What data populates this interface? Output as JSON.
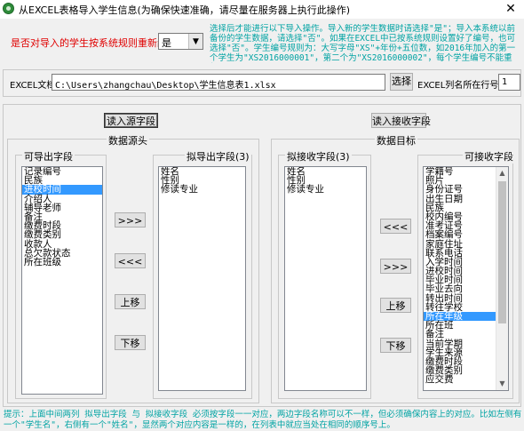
{
  "window": {
    "title": "从EXCEL表格导入学生信息(为确保快速准确，请尽量在服务器上执行此操作)",
    "close_glyph": "✕"
  },
  "top": {
    "renumber_label": "是否对导入的学生按系统规则重新编号",
    "renumber_value": "是",
    "renumber_help": "选择后才能进行以下导入操作。导入新的学生数据时请选择\"是\"；导入本系统以前备份的学生数据，请选择\"否\"。如果在EXCEL中已按系统规则设置好了编号，也可选择\"否\"。学生编号规则为：大写字母\"XS\"+年份+五位数，如2016年加入的第一个学生为\"XS2016000001\"，第二个为\"XS2016000002\"，每个学生编号不能重复。"
  },
  "file": {
    "label": "EXCEL文档",
    "path": "C:\\Users\\zhangchau\\Desktop\\学生信息表1.xlsx",
    "browse_label": "选择",
    "header_row_label": "EXCEL列名所在行号",
    "header_row_value": "1"
  },
  "source": {
    "load_button": "读入源字段",
    "group_title": "数据源头",
    "available_title": "可导出字段",
    "available_items": [
      "记录编号",
      "民族",
      "进校时间",
      "介绍人",
      "辅导老师",
      "备注",
      "缴费时段",
      "缴费类别",
      "收款人",
      "总欠款状态",
      "所在班级"
    ],
    "available_selected": 2,
    "export_title": "拟导出字段(3)",
    "export_items": [
      "姓名",
      "性别",
      "修读专业"
    ]
  },
  "target": {
    "load_button": "读入接收字段",
    "group_title": "数据目标",
    "receive_title": "拟接收字段(3)",
    "receive_items": [
      "姓名",
      "性别",
      "修读专业"
    ],
    "available_title": "可接收字段",
    "available_items": [
      "学籍号",
      "照片",
      "身份证号",
      "出生日期",
      "民族",
      "校内编号",
      "准考证号",
      "档案编号",
      "家庭住址",
      "联系电话",
      "入学时间",
      "进校时间",
      "毕业时间",
      "毕业去向",
      "转出时间",
      "转往学校",
      "所在年级",
      "所在班",
      "备注",
      "当前学期",
      "学生来源",
      "缴费时段",
      "缴费类别",
      "应交费"
    ],
    "available_selected": 16
  },
  "buttons": {
    "move_right": ">>>",
    "move_left": "<<<",
    "move_up": "上移",
    "move_down": "下移"
  },
  "hint": "提示：上面中间两列 拟导出字段 与 拟接收字段 必须按字段一一对应，两边字段名称可以不一样，但必须确保内容上的对应。比如左侧有一个\"学生名\"，右侧有一个\"姓名\"，显然两个对应内容是一样的，在列表中就应当处在相同的顺序号上。"
}
